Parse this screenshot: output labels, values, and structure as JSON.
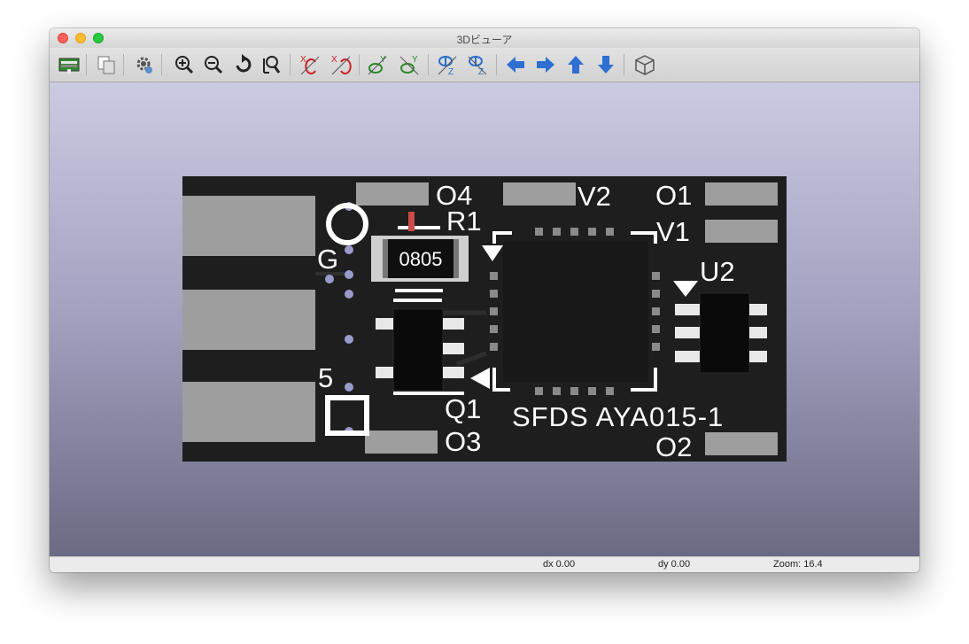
{
  "window": {
    "title": "3Dビューア"
  },
  "toolbar": {
    "buttons": [
      "render-icon",
      "copy-icon",
      "settings-icon",
      "zoom-in-icon",
      "zoom-out-icon",
      "redraw-icon",
      "zoom-fit-icon",
      "rotate-x-cw-icon",
      "rotate-x-ccw-icon",
      "rotate-y-cw-icon",
      "rotate-y-ccw-icon",
      "rotate-z-cw-icon",
      "rotate-z-ccw-icon",
      "pan-left-icon",
      "pan-right-icon",
      "pan-up-icon",
      "pan-down-icon",
      "ortho-cube-icon"
    ],
    "axis_labels": {
      "x": "X",
      "y": "Y",
      "z": "Z"
    }
  },
  "pcb": {
    "labels": {
      "o4": "O4",
      "r1": "R1",
      "v2": "V2",
      "o1": "O1",
      "v1": "V1",
      "g": "G",
      "u2": "U2",
      "five": "5",
      "q1": "Q1",
      "silk": "SFDS AYA015-1",
      "o3": "O3",
      "o2": "O2"
    },
    "resistor_code": "0805",
    "colors": {
      "board": "#1e1e1e",
      "pad": "#9e9e9e",
      "silkscreen": "#ffffff"
    }
  },
  "status": {
    "dx": "dx 0.00",
    "dy": "dy 0.00",
    "zoom": "Zoom: 16.4"
  }
}
